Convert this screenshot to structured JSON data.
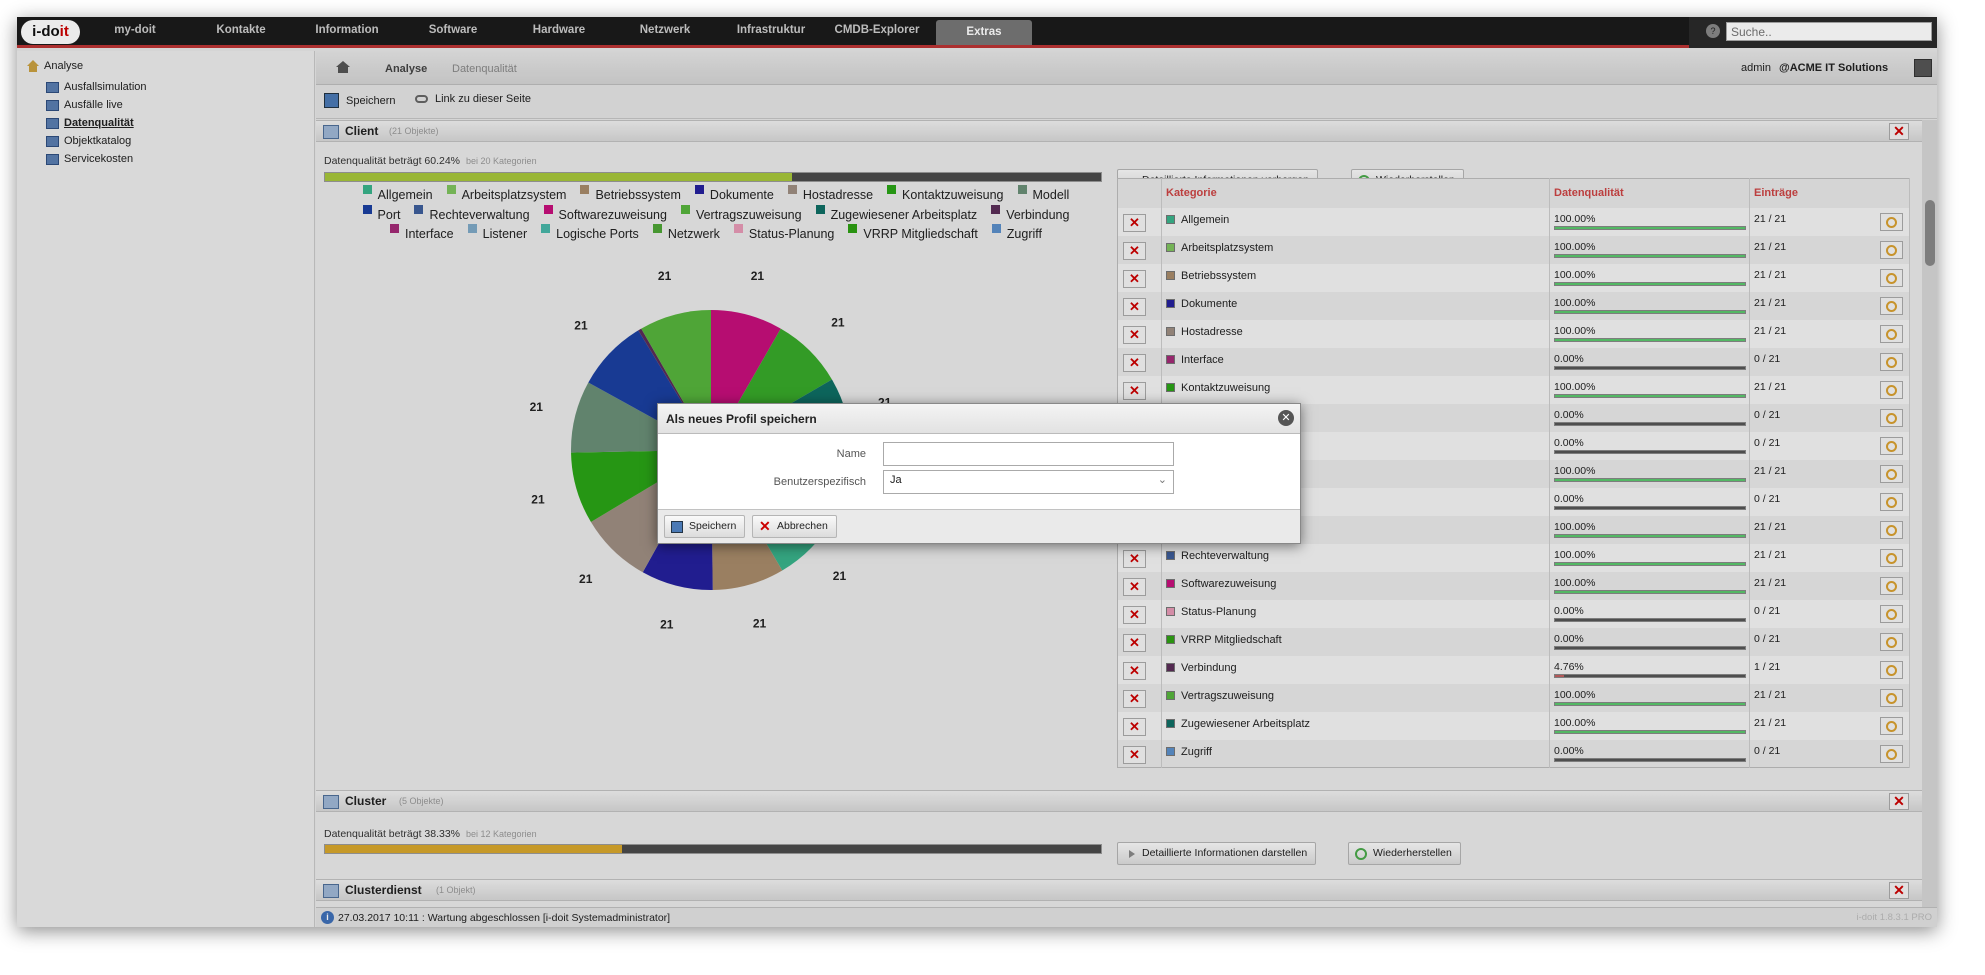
{
  "logo": {
    "pre": "i-do",
    "accent": "it"
  },
  "nav": [
    "my-doit",
    "Kontakte",
    "Information",
    "Software",
    "Hardware",
    "Netzwerk",
    "Infrastruktur",
    "CMDB-Explorer"
  ],
  "nav_active": "Extras",
  "search": {
    "placeholder": "Suche.."
  },
  "sidebar": {
    "root": "Analyse",
    "items": [
      {
        "label": "Ausfallsimulation"
      },
      {
        "label": "Ausfälle live"
      },
      {
        "label": "Datenqualität"
      },
      {
        "label": "Objektkatalog"
      },
      {
        "label": "Servicekosten"
      }
    ]
  },
  "breadcrumb": {
    "items": [
      "Analyse",
      "Datenqualität"
    ]
  },
  "user": {
    "name": "admin",
    "org": "@ACME IT Solutions"
  },
  "toolbar": {
    "save": "Speichern",
    "link": "Link zu dieser Seite"
  },
  "client": {
    "title": "Client",
    "count": "(21 Objekte)",
    "dq_text": "Datenqualität beträgt 60.24%",
    "dq_sub": "bei 20 Kategorien",
    "progress": 0.6024,
    "btn_toggle": "Detaillierte Informationen verbergen",
    "btn_restore": "Wiederherstellen",
    "table_headers": [
      "Kategorie",
      "Datenqualität",
      "Einträge"
    ]
  },
  "chart_data": {
    "type": "pie",
    "categories": [
      "Allgemein",
      "Arbeitsplatzsystem",
      "Betriebssystem",
      "Dokumente",
      "Hostadresse",
      "Kontaktzuweisung",
      "Modell",
      "Port",
      "Rechteverwaltung",
      "Softwarezuweisung",
      "Vertragszuweisung",
      "Zugewiesener Arbeitsplatz",
      "Verbindung",
      "Interface",
      "Listener",
      "Logische Ports",
      "Netzwerk",
      "Status-Planung",
      "VRRP Mitgliedschaft",
      "Zugriff"
    ],
    "values": [
      21,
      21,
      21,
      21,
      21,
      21,
      21,
      21,
      21,
      21,
      21,
      21,
      1,
      0,
      0,
      0,
      21,
      0,
      0,
      0
    ],
    "colors": [
      "#39b28a",
      "#7ec35e",
      "#a88a6a",
      "#24209c",
      "#9e8e82",
      "#2aa316",
      "#6a8f77",
      "#1b3fa0",
      "#3d5e9b",
      "#c60f7b",
      "#56b33c",
      "#0f6e64",
      "#5a2d57",
      "#a22a76",
      "#7ea9c6",
      "#48b6a8",
      "#4ea436",
      "#e79ab6",
      "#2ea013",
      "#5b8fc9"
    ],
    "label_value": "21"
  },
  "dq_rows": [
    {
      "cat": "Allgemein",
      "color": "#39b28a",
      "dq": "100.00%",
      "pct": 1.0,
      "entries": "21 / 21"
    },
    {
      "cat": "Arbeitsplatzsystem",
      "color": "#7ec35e",
      "dq": "100.00%",
      "pct": 1.0,
      "entries": "21 / 21"
    },
    {
      "cat": "Betriebssystem",
      "color": "#a88a6a",
      "dq": "100.00%",
      "pct": 1.0,
      "entries": "21 / 21"
    },
    {
      "cat": "Dokumente",
      "color": "#24209c",
      "dq": "100.00%",
      "pct": 1.0,
      "entries": "21 / 21"
    },
    {
      "cat": "Hostadresse",
      "color": "#9e8e82",
      "dq": "100.00%",
      "pct": 1.0,
      "entries": "21 / 21"
    },
    {
      "cat": "Interface",
      "color": "#a22a76",
      "dq": "0.00%",
      "pct": 0.0,
      "entries": "0 / 21"
    },
    {
      "cat": "Kontaktzuweisung",
      "color": "#2aa316",
      "dq": "100.00%",
      "pct": 1.0,
      "entries": "21 / 21"
    },
    {
      "cat": "",
      "color": "",
      "dq": "0.00%",
      "pct": 0.0,
      "entries": "0 / 21"
    },
    {
      "cat": "",
      "color": "",
      "dq": "0.00%",
      "pct": 0.0,
      "entries": "0 / 21"
    },
    {
      "cat": "",
      "color": "",
      "dq": "100.00%",
      "pct": 1.0,
      "entries": "21 / 21"
    },
    {
      "cat": "",
      "color": "",
      "dq": "0.00%",
      "pct": 0.0,
      "entries": "0 / 21"
    },
    {
      "cat": "",
      "color": "",
      "dq": "100.00%",
      "pct": 1.0,
      "entries": "21 / 21"
    },
    {
      "cat": "Rechteverwaltung",
      "color": "#3d5e9b",
      "dq": "100.00%",
      "pct": 1.0,
      "entries": "21 / 21"
    },
    {
      "cat": "Softwarezuweisung",
      "color": "#c60f7b",
      "dq": "100.00%",
      "pct": 1.0,
      "entries": "21 / 21"
    },
    {
      "cat": "Status-Planung",
      "color": "#e79ab6",
      "dq": "0.00%",
      "pct": 0.0,
      "entries": "0 / 21"
    },
    {
      "cat": "VRRP Mitgliedschaft",
      "color": "#2ea013",
      "dq": "0.00%",
      "pct": 0.0,
      "entries": "0 / 21"
    },
    {
      "cat": "Verbindung",
      "color": "#5a2d57",
      "dq": "4.76%",
      "pct": 0.0476,
      "entries": "1 / 21"
    },
    {
      "cat": "Vertragszuweisung",
      "color": "#56b33c",
      "dq": "100.00%",
      "pct": 1.0,
      "entries": "21 / 21"
    },
    {
      "cat": "Zugewiesener Arbeitsplatz",
      "color": "#0f6e64",
      "dq": "100.00%",
      "pct": 1.0,
      "entries": "21 / 21"
    },
    {
      "cat": "Zugriff",
      "color": "#5b8fc9",
      "dq": "0.00%",
      "pct": 0.0,
      "entries": "0 / 21"
    }
  ],
  "cluster": {
    "title": "Cluster",
    "count": "(5 Objekte)",
    "dq_text": "Datenqualität beträgt 38.33%",
    "dq_sub": "bei 12 Kategorien",
    "progress": 0.3833,
    "btn_toggle": "Detaillierte Informationen darstellen",
    "btn_restore": "Wiederherstellen"
  },
  "clusterdienst": {
    "title": "Clusterdienst",
    "count": "(1 Objekt)"
  },
  "status": {
    "text": "27.03.2017 10:11 : Wartung abgeschlossen [i-doit Systemadministrator]",
    "version": "i-doit 1.8.3.1 PRO"
  },
  "modal": {
    "title": "Als neues Profil speichern",
    "name_label": "Name",
    "name_value": "",
    "user_label": "Benutzerspezifisch",
    "user_value": "Ja",
    "save": "Speichern",
    "cancel": "Abbrechen"
  },
  "colors": {
    "accent": "#b33333",
    "progress_client": "#a7c63a",
    "progress_cluster": "#d7a72c",
    "bar_ok": "#5bc86d"
  }
}
